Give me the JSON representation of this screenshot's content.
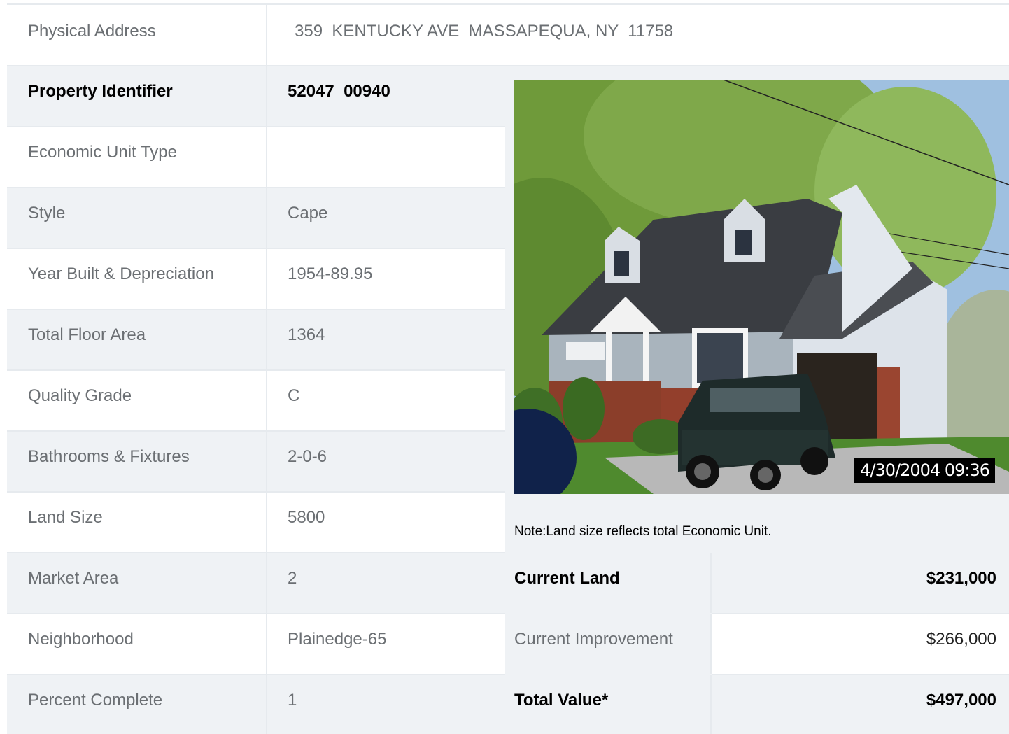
{
  "address": {
    "label": "Physical Address",
    "value": "359  KENTUCKY AVE  MASSAPEQUA, NY  11758"
  },
  "property_rows": [
    {
      "label": "Property Identifier",
      "value": "52047  00940",
      "bold": true
    },
    {
      "label": "Economic Unit Type",
      "value": ""
    },
    {
      "label": "Style",
      "value": "Cape"
    },
    {
      "label": "Year Built & Depreciation",
      "value": "1954-89.95"
    },
    {
      "label": "Total Floor Area",
      "value": "1364"
    },
    {
      "label": "Quality Grade",
      "value": "C"
    },
    {
      "label": "Bathrooms & Fixtures",
      "value": "2-0-6"
    },
    {
      "label": "Land Size",
      "value": "5800"
    },
    {
      "label": "Market Area",
      "value": "2"
    },
    {
      "label": "Neighborhood",
      "value": "Plainedge-65"
    },
    {
      "label": "Percent Complete",
      "value": "1"
    }
  ],
  "photo": {
    "timestamp": "4/30/2004 09:36"
  },
  "note": "Note:Land size reflects total Economic Unit.",
  "values": {
    "current_land": {
      "label": "Current Land",
      "value": "$231,000"
    },
    "current_improvement": {
      "label": "Current Improvement",
      "value": "$266,000"
    },
    "total_value": {
      "label": "Total Value*",
      "value": "$497,000"
    }
  }
}
